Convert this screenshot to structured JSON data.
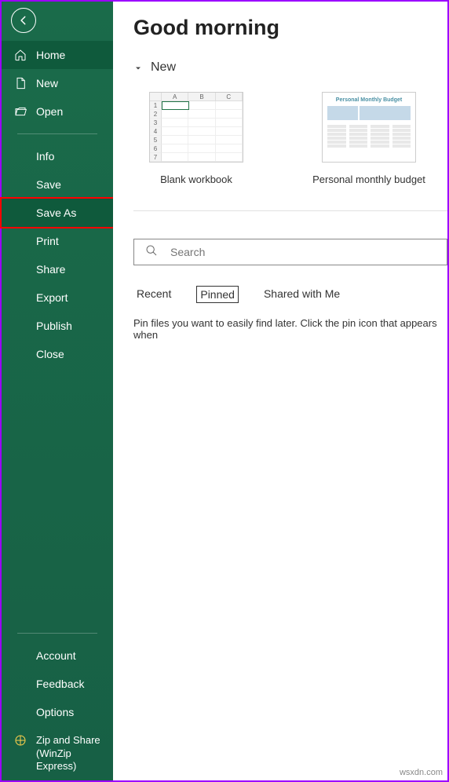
{
  "header": {
    "title": "Good morning"
  },
  "sidebar": {
    "top": [
      {
        "label": "Home",
        "icon": "home"
      },
      {
        "label": "New",
        "icon": "document"
      },
      {
        "label": "Open",
        "icon": "folder"
      }
    ],
    "middle": [
      {
        "label": "Info"
      },
      {
        "label": "Save"
      },
      {
        "label": "Save As"
      },
      {
        "label": "Print"
      },
      {
        "label": "Share"
      },
      {
        "label": "Export"
      },
      {
        "label": "Publish"
      },
      {
        "label": "Close"
      }
    ],
    "bottom": [
      {
        "label": "Account"
      },
      {
        "label": "Feedback"
      },
      {
        "label": "Options"
      },
      {
        "label": "Zip and Share (WinZip Express)",
        "icon": "zip"
      }
    ]
  },
  "new_section": {
    "label": "New",
    "templates": [
      {
        "label": "Blank workbook"
      },
      {
        "label": "Personal monthly budget"
      }
    ]
  },
  "search": {
    "placeholder": "Search"
  },
  "tabs": [
    {
      "label": "Recent",
      "active": false
    },
    {
      "label": "Pinned",
      "active": true
    },
    {
      "label": "Shared with Me",
      "active": false
    }
  ],
  "hint": "Pin files you want to easily find later. Click the pin icon that appears when",
  "watermark": "wsxdn.com"
}
